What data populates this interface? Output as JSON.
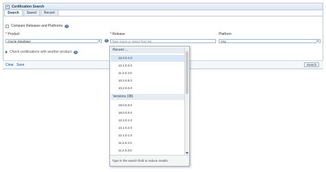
{
  "panel": {
    "title": "Certification Search",
    "tabs": [
      "Search",
      "Saved",
      "Recent"
    ]
  },
  "compare": {
    "label": "Compare Releases and Platforms"
  },
  "product": {
    "label": "Product",
    "value": "Oracle Database"
  },
  "release": {
    "label": "Release",
    "placeholder": "Type name or select from list"
  },
  "platform": {
    "label": "Platform",
    "value": "Any"
  },
  "check_another": {
    "label": "Check certifications with another product"
  },
  "actions": {
    "clear": "Clear",
    "save": "Save",
    "search": "Search"
  },
  "dropdown": {
    "recent_header": "Recent :...",
    "recent_items": [
      "12.2.0.1.0",
      "12.1.0.2.0",
      "11.2.0.4.0",
      "10.2.0.5.0",
      "10.2.0.4.0"
    ],
    "versions_header": "Versions (38)",
    "version_items": [
      "19.0.0.0.0",
      "18.0.0.0.0",
      "12.2.0.1.0",
      "12.1.0.2.0",
      "12.1.0.1.0",
      "11.2.0.4.0",
      "11.2.0.3.0"
    ],
    "footer": "Type in the search field to reduce results."
  }
}
